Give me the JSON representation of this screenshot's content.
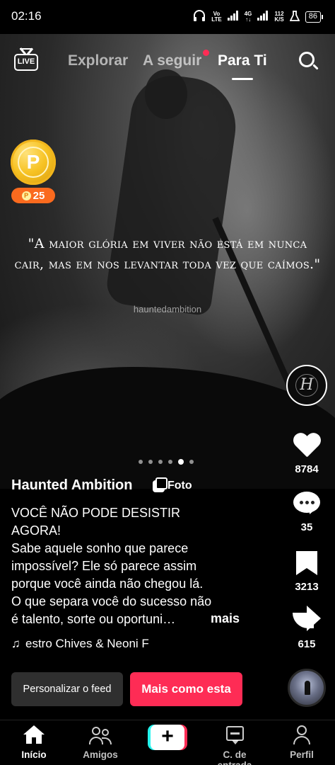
{
  "status_bar": {
    "time": "02:16",
    "network_1_top": "Vo",
    "network_1_bottom": "LTE",
    "network_2_top": "4G",
    "network_2_bottom": "↑↓",
    "speed_top": "112",
    "speed_bottom": "K/S",
    "battery": "86"
  },
  "top_nav": {
    "live_label": "LIVE",
    "tabs": [
      {
        "label": "Explorar",
        "active": false
      },
      {
        "label": "A seguir",
        "active": false,
        "has_notification_dot": true
      },
      {
        "label": "Para Ti",
        "active": true
      }
    ]
  },
  "coin": {
    "symbol": "P",
    "badge_symbol": "P",
    "badge_value": "25"
  },
  "post": {
    "quote": "\"A maior glória em viver não está em nunca cair, mas em nos levantar toda vez que caímos.\"",
    "watermark": "hauntedambition",
    "avatar_monogram": "H",
    "carousel": {
      "count": 6,
      "active_index": 4
    },
    "username": "Haunted Ambition",
    "type_label": "Foto",
    "caption_lines": [
      "VOCÊ NÃO PODE DESISTIR",
      "AGORA!",
      "Sabe aquele sonho que parece",
      "impossível? Ele só parece assim",
      "porque você ainda não chegou lá.",
      "O que separa você do sucesso não",
      "é talento, sorte ou oportuni…"
    ],
    "more_label": "mais",
    "music_text": "estro Chives & Neoni   F"
  },
  "actions": {
    "likes": "8784",
    "comments": "35",
    "saves": "3213",
    "shares": "615"
  },
  "buttons": {
    "personalize": "Personalizar o feed",
    "more_like_this": "Mais como esta"
  },
  "bottom_nav": {
    "items": [
      {
        "label": "Início",
        "icon": "home-icon",
        "active": true
      },
      {
        "label": "Amigos",
        "icon": "friends-icon",
        "active": false
      },
      {
        "label": "",
        "icon": "plus-icon",
        "active": false
      },
      {
        "label": "C. de entrada",
        "icon": "inbox-icon",
        "active": false
      },
      {
        "label": "Perfil",
        "icon": "profile-icon",
        "active": false
      }
    ]
  },
  "colors": {
    "accent": "#fe2c55",
    "secondary_accent": "#25f4ee",
    "coin_badge": "#fa6a1e",
    "coin_gold": "#f7c324"
  }
}
